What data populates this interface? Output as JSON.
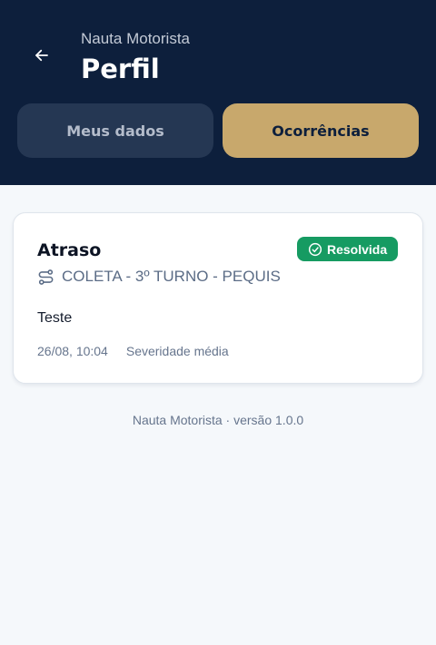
{
  "header": {
    "app_name": "Nauta Motorista",
    "title": "Perfil",
    "back_icon": "arrow-left-icon",
    "background_color": "#0d1f3c"
  },
  "tabs": [
    {
      "label": "Meus dados",
      "active": false
    },
    {
      "label": "Ocorrências",
      "active": true
    }
  ],
  "occurrences": [
    {
      "title": "Atraso",
      "status": "Resolvida",
      "status_color": "#169b62",
      "status_icon": "check-circle-icon",
      "route_icon": "route-icon",
      "route": "COLETA - 3º TURNO - PEQUIS",
      "description": "Teste",
      "datetime": "26/08, 10:04",
      "severity": "Severidade média"
    }
  ],
  "footer": {
    "version_text": "Nauta Motorista · versão 1.0.0"
  }
}
